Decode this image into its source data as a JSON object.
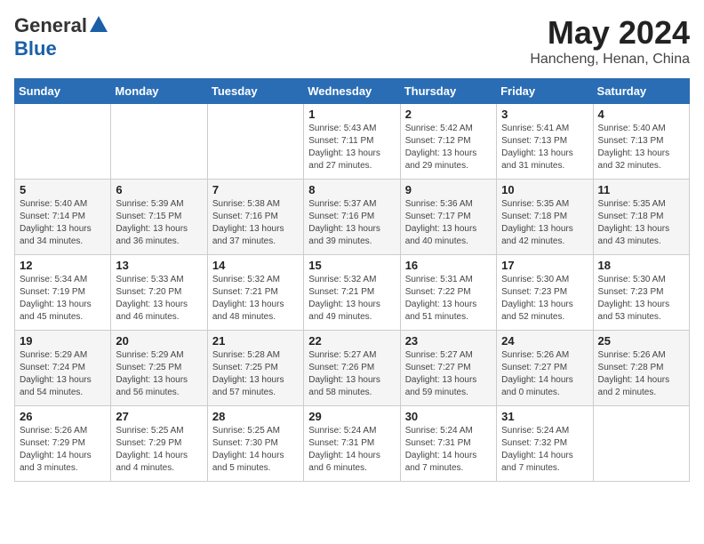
{
  "header": {
    "logo_general": "General",
    "logo_blue": "Blue",
    "month_title": "May 2024",
    "location": "Hancheng, Henan, China"
  },
  "weekdays": [
    "Sunday",
    "Monday",
    "Tuesday",
    "Wednesday",
    "Thursday",
    "Friday",
    "Saturday"
  ],
  "weeks": [
    [
      {
        "day": "",
        "info": ""
      },
      {
        "day": "",
        "info": ""
      },
      {
        "day": "",
        "info": ""
      },
      {
        "day": "1",
        "info": "Sunrise: 5:43 AM\nSunset: 7:11 PM\nDaylight: 13 hours\nand 27 minutes."
      },
      {
        "day": "2",
        "info": "Sunrise: 5:42 AM\nSunset: 7:12 PM\nDaylight: 13 hours\nand 29 minutes."
      },
      {
        "day": "3",
        "info": "Sunrise: 5:41 AM\nSunset: 7:13 PM\nDaylight: 13 hours\nand 31 minutes."
      },
      {
        "day": "4",
        "info": "Sunrise: 5:40 AM\nSunset: 7:13 PM\nDaylight: 13 hours\nand 32 minutes."
      }
    ],
    [
      {
        "day": "5",
        "info": "Sunrise: 5:40 AM\nSunset: 7:14 PM\nDaylight: 13 hours\nand 34 minutes."
      },
      {
        "day": "6",
        "info": "Sunrise: 5:39 AM\nSunset: 7:15 PM\nDaylight: 13 hours\nand 36 minutes."
      },
      {
        "day": "7",
        "info": "Sunrise: 5:38 AM\nSunset: 7:16 PM\nDaylight: 13 hours\nand 37 minutes."
      },
      {
        "day": "8",
        "info": "Sunrise: 5:37 AM\nSunset: 7:16 PM\nDaylight: 13 hours\nand 39 minutes."
      },
      {
        "day": "9",
        "info": "Sunrise: 5:36 AM\nSunset: 7:17 PM\nDaylight: 13 hours\nand 40 minutes."
      },
      {
        "day": "10",
        "info": "Sunrise: 5:35 AM\nSunset: 7:18 PM\nDaylight: 13 hours\nand 42 minutes."
      },
      {
        "day": "11",
        "info": "Sunrise: 5:35 AM\nSunset: 7:18 PM\nDaylight: 13 hours\nand 43 minutes."
      }
    ],
    [
      {
        "day": "12",
        "info": "Sunrise: 5:34 AM\nSunset: 7:19 PM\nDaylight: 13 hours\nand 45 minutes."
      },
      {
        "day": "13",
        "info": "Sunrise: 5:33 AM\nSunset: 7:20 PM\nDaylight: 13 hours\nand 46 minutes."
      },
      {
        "day": "14",
        "info": "Sunrise: 5:32 AM\nSunset: 7:21 PM\nDaylight: 13 hours\nand 48 minutes."
      },
      {
        "day": "15",
        "info": "Sunrise: 5:32 AM\nSunset: 7:21 PM\nDaylight: 13 hours\nand 49 minutes."
      },
      {
        "day": "16",
        "info": "Sunrise: 5:31 AM\nSunset: 7:22 PM\nDaylight: 13 hours\nand 51 minutes."
      },
      {
        "day": "17",
        "info": "Sunrise: 5:30 AM\nSunset: 7:23 PM\nDaylight: 13 hours\nand 52 minutes."
      },
      {
        "day": "18",
        "info": "Sunrise: 5:30 AM\nSunset: 7:23 PM\nDaylight: 13 hours\nand 53 minutes."
      }
    ],
    [
      {
        "day": "19",
        "info": "Sunrise: 5:29 AM\nSunset: 7:24 PM\nDaylight: 13 hours\nand 54 minutes."
      },
      {
        "day": "20",
        "info": "Sunrise: 5:29 AM\nSunset: 7:25 PM\nDaylight: 13 hours\nand 56 minutes."
      },
      {
        "day": "21",
        "info": "Sunrise: 5:28 AM\nSunset: 7:25 PM\nDaylight: 13 hours\nand 57 minutes."
      },
      {
        "day": "22",
        "info": "Sunrise: 5:27 AM\nSunset: 7:26 PM\nDaylight: 13 hours\nand 58 minutes."
      },
      {
        "day": "23",
        "info": "Sunrise: 5:27 AM\nSunset: 7:27 PM\nDaylight: 13 hours\nand 59 minutes."
      },
      {
        "day": "24",
        "info": "Sunrise: 5:26 AM\nSunset: 7:27 PM\nDaylight: 14 hours\nand 0 minutes."
      },
      {
        "day": "25",
        "info": "Sunrise: 5:26 AM\nSunset: 7:28 PM\nDaylight: 14 hours\nand 2 minutes."
      }
    ],
    [
      {
        "day": "26",
        "info": "Sunrise: 5:26 AM\nSunset: 7:29 PM\nDaylight: 14 hours\nand 3 minutes."
      },
      {
        "day": "27",
        "info": "Sunrise: 5:25 AM\nSunset: 7:29 PM\nDaylight: 14 hours\nand 4 minutes."
      },
      {
        "day": "28",
        "info": "Sunrise: 5:25 AM\nSunset: 7:30 PM\nDaylight: 14 hours\nand 5 minutes."
      },
      {
        "day": "29",
        "info": "Sunrise: 5:24 AM\nSunset: 7:31 PM\nDaylight: 14 hours\nand 6 minutes."
      },
      {
        "day": "30",
        "info": "Sunrise: 5:24 AM\nSunset: 7:31 PM\nDaylight: 14 hours\nand 7 minutes."
      },
      {
        "day": "31",
        "info": "Sunrise: 5:24 AM\nSunset: 7:32 PM\nDaylight: 14 hours\nand 7 minutes."
      },
      {
        "day": "",
        "info": ""
      }
    ]
  ]
}
